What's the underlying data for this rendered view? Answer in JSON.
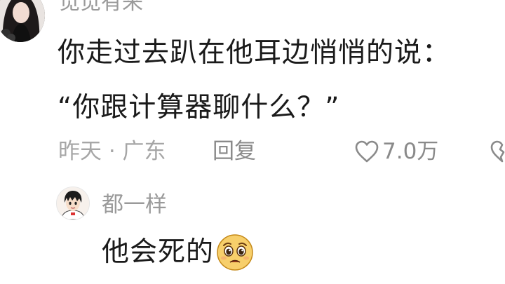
{
  "comment": {
    "username": "觅觅有来^",
    "line1": "你走过去趴在他耳边悄悄的说：",
    "line2": "“你跟计算器聊什么？”",
    "meta_time_location": "昨天 · 广东",
    "reply_label": "回复",
    "like_count": "7.0万",
    "icons": {
      "avatar": "user-avatar-photo",
      "like": "heart-outline-icon",
      "dislike": "broken-heart-icon"
    }
  },
  "reply": {
    "username": "都一样",
    "text": "他会死的",
    "icons": {
      "avatar": "anime-boy-avatar",
      "emoji": "pleading-face-emoji"
    }
  },
  "colors": {
    "text_primary": "#1a1a1a",
    "text_secondary": "#9a9a9a",
    "background": "#ffffff"
  }
}
